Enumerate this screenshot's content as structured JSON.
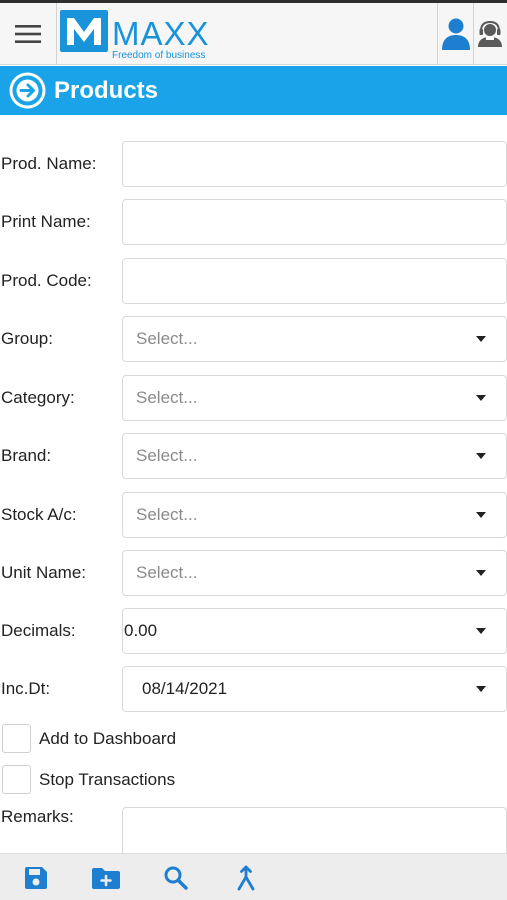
{
  "header": {
    "menu_icon": "hamburger-icon",
    "logo_letter": "M",
    "logo_word": "MAXX",
    "logo_tagline": "Freedom of business",
    "user_icon": "user-icon",
    "support_icon": "support-agent-icon"
  },
  "page": {
    "title": "Products",
    "title_icon": "arrow-circle-right-icon"
  },
  "form": {
    "prod_name": {
      "label": "Prod. Name:",
      "value": ""
    },
    "print_name": {
      "label": "Print Name:",
      "value": ""
    },
    "prod_code": {
      "label": "Prod. Code:",
      "value": ""
    },
    "group": {
      "label": "Group:",
      "placeholder": "Select..."
    },
    "category": {
      "label": "Category:",
      "placeholder": "Select..."
    },
    "brand": {
      "label": "Brand:",
      "placeholder": "Select..."
    },
    "stock_ac": {
      "label": "Stock A/c:",
      "placeholder": "Select..."
    },
    "unit_name": {
      "label": "Unit Name:",
      "placeholder": "Select..."
    },
    "decimals": {
      "label": "Decimals:",
      "value": "0.00"
    },
    "inc_dt": {
      "label": "Inc.Dt:",
      "value": "08/14/2021"
    },
    "add_to_dashboard": {
      "label": "Add to Dashboard",
      "checked": false
    },
    "stop_transactions": {
      "label": "Stop Transactions",
      "checked": false
    },
    "remarks": {
      "label": "Remarks:",
      "value": ""
    }
  },
  "toolbar": {
    "save_icon": "save-icon",
    "new_folder_icon": "folder-add-icon",
    "search_icon": "search-icon",
    "merge_icon": "merge-icon"
  },
  "colors": {
    "accent": "#1aa3e8",
    "logo_blue": "#1993d9",
    "icon_blue": "#1e7fd0"
  }
}
